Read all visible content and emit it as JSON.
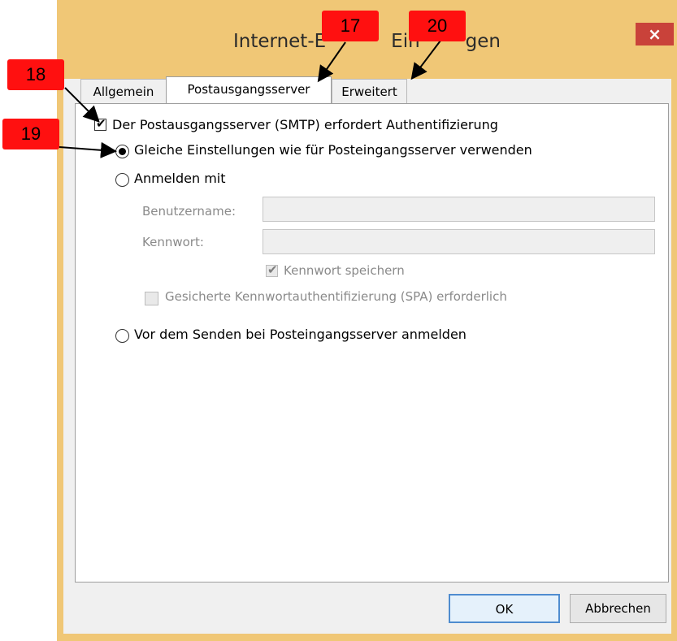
{
  "window": {
    "title": "Internet-E-Mail-Einstellungen",
    "title_visible": "Internet-E",
    "title_visible_2": "Ein",
    "title_visible_3": "gen",
    "close_glyph": "×"
  },
  "tabs": [
    {
      "label": "Allgemein"
    },
    {
      "label": "Postausgangsserver"
    },
    {
      "label": "Erweitert"
    }
  ],
  "panel": {
    "smtp_auth_label": "Der Postausgangsserver (SMTP) erfordert Authentifizierung",
    "radio_same_label": "Gleiche Einstellungen wie für Posteingangsserver verwenden",
    "radio_login_label": "Anmelden mit",
    "username_label": "Benutzername:",
    "password_label": "Kennwort:",
    "save_password_label": "Kennwort speichern",
    "spa_label": "Gesicherte Kennwortauthentifizierung (SPA) erforderlich",
    "radio_before_send_label": "Vor dem Senden bei Posteingangsserver anmelden",
    "username_value": "",
    "password_value": ""
  },
  "buttons": {
    "ok": "OK",
    "cancel": "Abbrechen"
  },
  "badges": {
    "b17": "17",
    "b18": "18",
    "b19": "19",
    "b20": "20"
  },
  "colors": {
    "badge": "#ff1010",
    "title_bar": "#f0c776",
    "close": "#c9423a",
    "ok_border": "#4f8ccf"
  }
}
